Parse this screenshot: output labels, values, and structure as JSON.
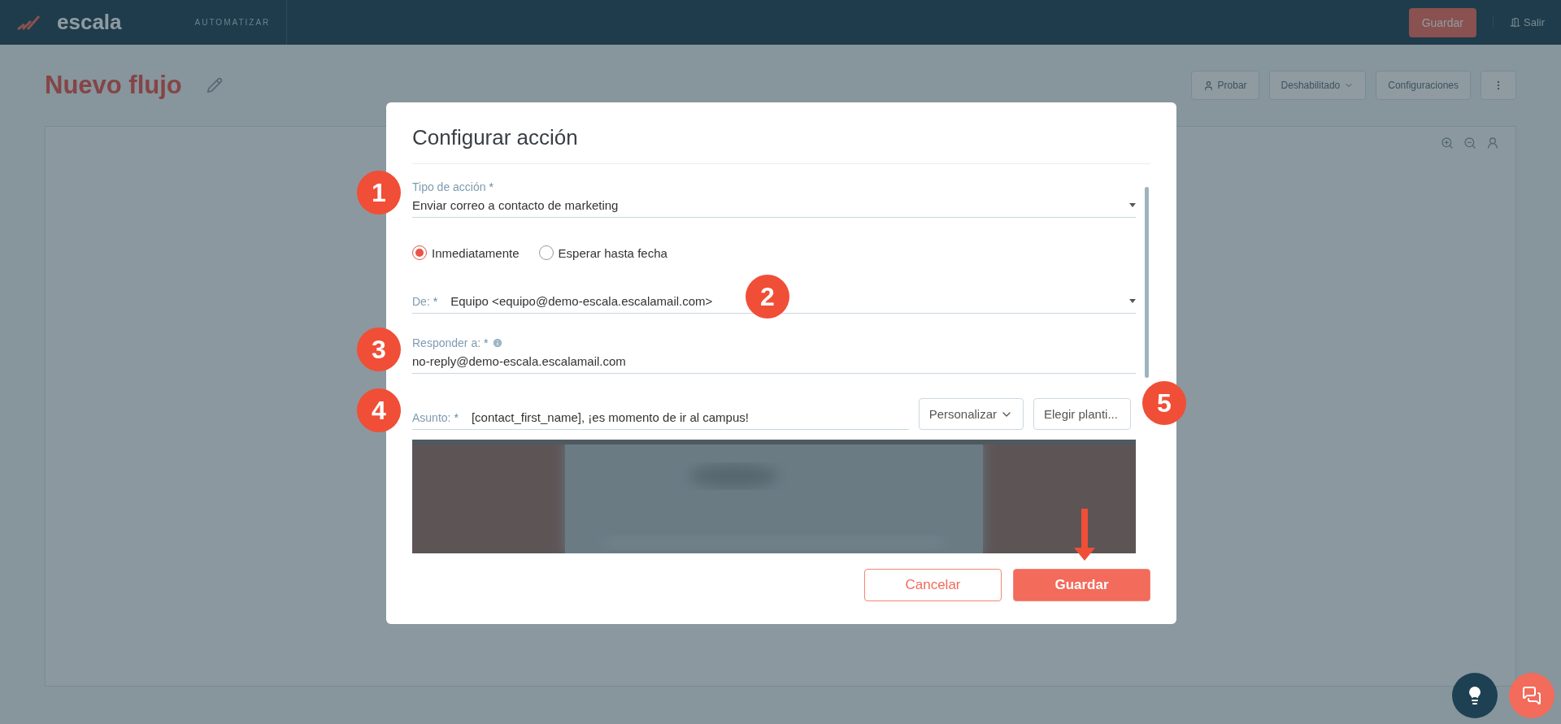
{
  "top_bar": {
    "logo": "escala",
    "section": "AUTOMATIZAR",
    "save_button": "Guardar",
    "exit_link": "Salir"
  },
  "flow": {
    "title": "Nuevo flujo",
    "actions": [
      {
        "label": "Probar",
        "kind": "user"
      },
      {
        "label": "Deshabilitado",
        "kind": "dropdown"
      },
      {
        "label": "Configuraciones",
        "kind": "plain"
      }
    ]
  },
  "dialog": {
    "title": "Configurar acción",
    "action_type": {
      "label": "Tipo de acción",
      "required_mark": "*",
      "value": "Enviar correo a contacto de marketing"
    },
    "timing": [
      {
        "label": "Inmediatamente",
        "selected": true
      },
      {
        "label": "Esperar hasta fecha",
        "selected": false
      }
    ],
    "from": {
      "label": "De:",
      "required_mark": "*",
      "value": "Equipo <equipo@demo-escala.escalamail.com>"
    },
    "reply_to": {
      "label": "Responder a:",
      "required_mark": "*",
      "value": "no-reply@demo-escala.escalamail.com"
    },
    "subject": {
      "label": "Asunto:",
      "required_mark": "*",
      "value": "[contact_first_name], ¡es momento de ir al campus!"
    },
    "personalize_button": "Personalizar",
    "template_button": "Elegir planti...",
    "buttons": [
      {
        "label": "Cancelar",
        "kind": "secondary"
      },
      {
        "label": "Guardar",
        "kind": "primary"
      }
    ]
  },
  "callouts": [
    "1",
    "2",
    "3",
    "4",
    "5"
  ]
}
